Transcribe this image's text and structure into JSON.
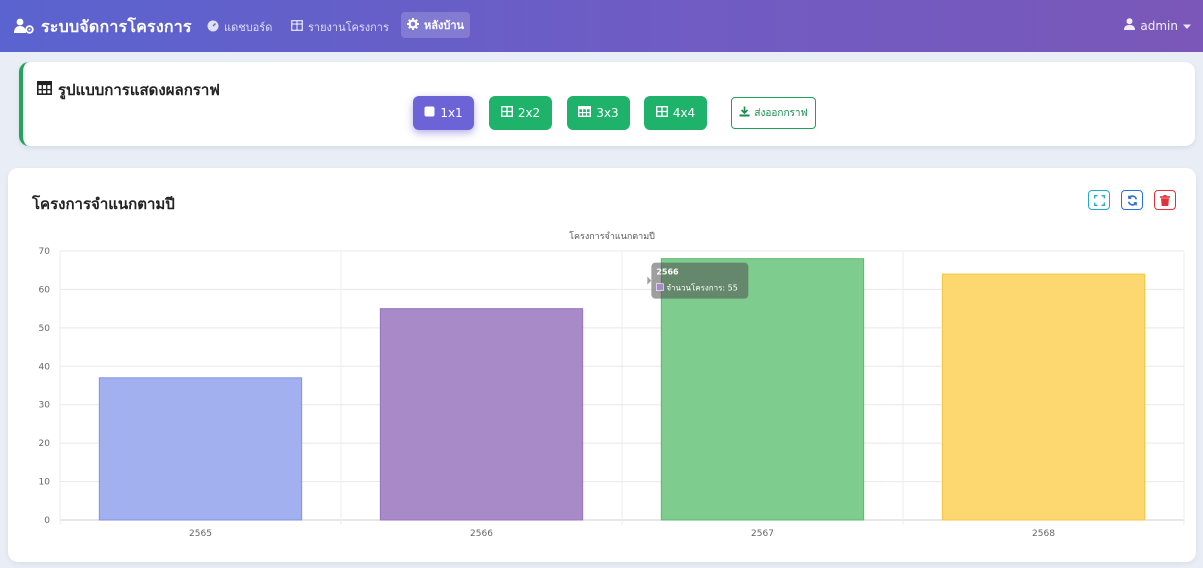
{
  "navbar": {
    "brand": "ระบบจัดการโครงการ",
    "items": [
      {
        "label": "แดชบอร์ด",
        "icon": "dashboard-icon"
      },
      {
        "label": "รายงานโครงการ",
        "icon": "table-icon"
      },
      {
        "label": "หลังบ้าน",
        "icon": "gear-icon"
      }
    ],
    "user": "admin"
  },
  "layout_panel": {
    "title": "รูปแบบการแสดงผลกราฟ",
    "buttons": [
      {
        "label": "1x1",
        "active": true
      },
      {
        "label": "2x2",
        "active": false
      },
      {
        "label": "3x3",
        "active": false
      },
      {
        "label": "4x4",
        "active": false
      }
    ],
    "export_label": "ส่งออกกราฟ"
  },
  "chart_card": {
    "title": "โครงการจำแนกตามปี"
  },
  "chart_data": {
    "type": "bar",
    "title": "โครงการจำแนกตามปี",
    "categories": [
      "2565",
      "2566",
      "2567",
      "2568"
    ],
    "values": [
      37,
      55,
      68,
      64
    ],
    "colors": [
      "#a2b0f0",
      "#a98ac9",
      "#7fcc8f",
      "#fdd870"
    ],
    "border_colors": [
      "#8292e6",
      "#9874bd",
      "#5bb86d",
      "#f5c542"
    ],
    "xlabel": "",
    "ylabel": "",
    "ylim": [
      0,
      70
    ],
    "yticks": [
      0,
      10,
      20,
      30,
      40,
      50,
      60,
      70
    ],
    "grid": true,
    "tooltip": {
      "category": "2566",
      "label": "จำนวนโครงการ: 55"
    }
  },
  "colors": {
    "accent": "#5a63cf",
    "green_button": "#1fb26b",
    "active_button": "#6c63d6"
  }
}
